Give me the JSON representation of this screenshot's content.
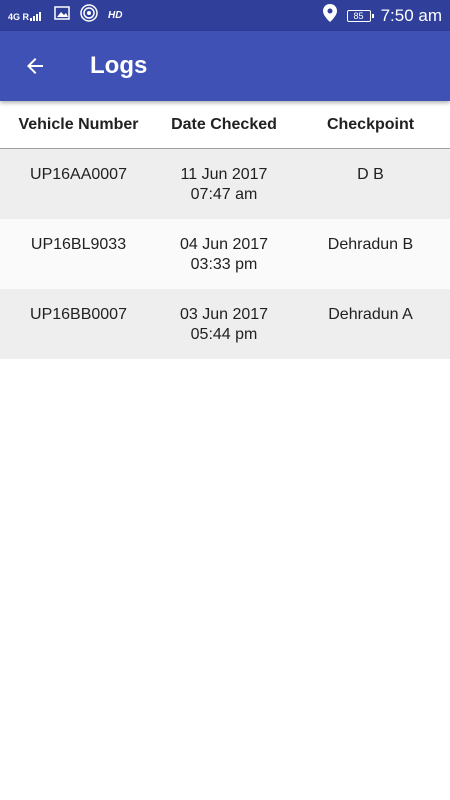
{
  "status_bar": {
    "network_type": "4G R",
    "hd_label": "HD",
    "battery_level": "85",
    "time": "7:50 am"
  },
  "app_bar": {
    "title": "Logs"
  },
  "table": {
    "headers": [
      "Vehicle Number",
      "Date Checked",
      "Checkpoint"
    ],
    "rows": [
      {
        "vehicle_number": "UP16AA0007",
        "date": "11 Jun 2017",
        "time": "07:47 am",
        "checkpoint": "D B"
      },
      {
        "vehicle_number": "UP16BL9033",
        "date": "04 Jun 2017",
        "time": "03:33 pm",
        "checkpoint": "Dehradun B"
      },
      {
        "vehicle_number": "UP16BB0007",
        "date": "03 Jun 2017",
        "time": "05:44 pm",
        "checkpoint": "Dehradun A"
      }
    ]
  }
}
